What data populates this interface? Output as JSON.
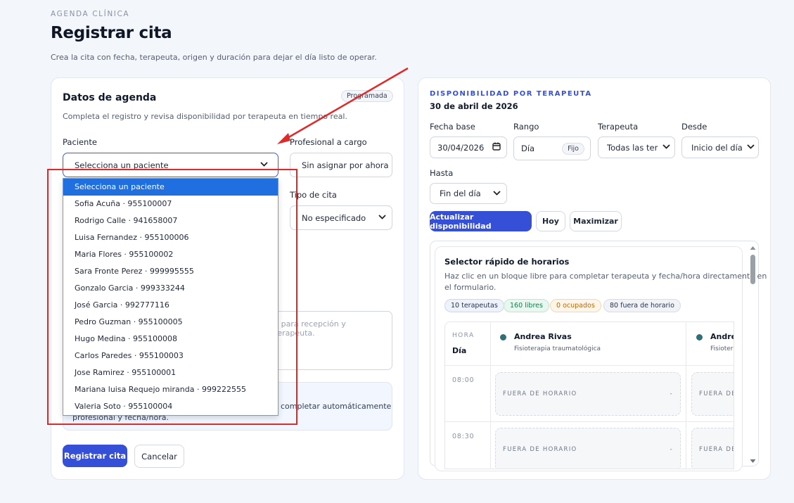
{
  "header": {
    "eyebrow": "AGENDA CLÍNICA",
    "title": "Registrar cita",
    "subtitle": "Crea la cita con fecha, terapeuta, origen y duración para dejar el día listo de operar."
  },
  "form": {
    "title": "Datos de agenda",
    "status_badge": "Programada",
    "subtitle": "Completa el registro y revisa disponibilidad por terapeuta en tiempo real.",
    "patient_label": "Paciente",
    "patient_value": "Selecciona un paciente",
    "professional_label": "Profesional a cargo",
    "professional_value": "Sin asignar por ahora",
    "type_label": "Tipo de cita",
    "type_value": "No especificado",
    "notes_placeholder_tail": "il para recepción y terapeuta.",
    "info_line1_tail": "completar automáticamente",
    "info_line2": "profesional y fecha/hora.",
    "submit_label": "Registrar cita",
    "cancel_label": "Cancelar"
  },
  "patient_options": [
    "Selecciona un paciente",
    "Sofia Acuña · 955100007",
    "Rodrigo Calle · 941658007",
    "Luisa Fernandez · 955100006",
    "Maria Flores · 955100002",
    "Sara Fronte Perez · 999995555",
    "Gonzalo Garcia · 999333244",
    "José Garcia · 992777116",
    "Pedro Guzman · 955100005",
    "Hugo Medina · 955100008",
    "Carlos Paredes · 955100003",
    "Jose Ramirez · 955100001",
    "Mariana luisa Requejo miranda · 999222555",
    "Valeria Soto · 955100004"
  ],
  "selected_option_index": 0,
  "availability": {
    "eyebrow": "DISPONIBILIDAD POR TERAPEUTA",
    "date": "30 de abril de 2026",
    "base_date_label": "Fecha base",
    "base_date_value": "30/04/2026",
    "range_label": "Rango",
    "range_value": "Día",
    "range_badge": "Fijo",
    "therapist_label": "Terapeuta",
    "therapist_value": "Todas las terapeutas",
    "from_label": "Desde",
    "from_value": "Inicio del día",
    "to_label": "Hasta",
    "to_value": "Fin del día",
    "refresh_label": "Actualizar disponibilidad",
    "today_label": "Hoy",
    "maximize_label": "Maximizar"
  },
  "quick_selector": {
    "title": "Selector rápido de horarios",
    "description_line1": "Haz clic en un bloque libre para completar terapeuta y fecha/hora directamente en",
    "description_line2": "el formulario.",
    "stats": {
      "therapists": "10 terapeutas",
      "free": "160 libres",
      "busy": "0 ocupados",
      "off_hours": "80 fuera de horario"
    },
    "hour_header": "HORA",
    "day_header": "Día",
    "columns": [
      {
        "name": "Andrea Rivas",
        "specialty": "Fisioterapia traumatológica"
      },
      {
        "name": "Andrea",
        "specialty": "Fisioterap"
      }
    ],
    "rows": [
      {
        "time": "08:00",
        "slot_label": "FUERA DE HORARIO",
        "slot_mark": "-",
        "slot_label_cut": "FUERA DE H"
      },
      {
        "time": "08:30",
        "slot_label": "FUERA DE HORARIO",
        "slot_mark": "-",
        "slot_label_cut": "FUERA DE H"
      }
    ]
  },
  "colors": {
    "primary": "#3550d6",
    "annotation": "#e02a2a",
    "option_selected": "#1f6fe0",
    "therapist_dot": "#2f6f78"
  }
}
